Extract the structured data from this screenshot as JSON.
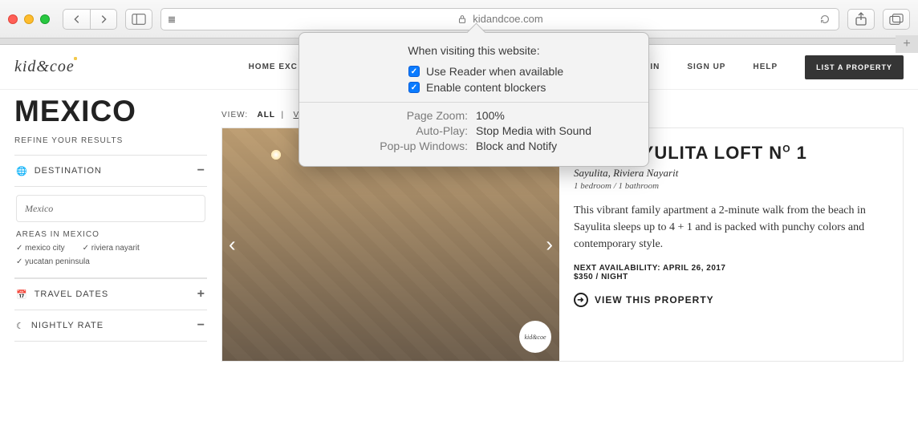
{
  "browser": {
    "url": "kidandcoe.com",
    "popover": {
      "title": "When visiting this website:",
      "useReader": "Use Reader when available",
      "contentBlockers": "Enable content blockers",
      "settings": [
        {
          "k": "Page Zoom:",
          "v": "100%"
        },
        {
          "k": "Auto-Play:",
          "v": "Stop Media with Sound"
        },
        {
          "k": "Pop-up Windows:",
          "v": "Block and Notify"
        }
      ]
    }
  },
  "site": {
    "logo": "kid&coe",
    "nav": {
      "homeExchange": "HOME EXC",
      "signIn": "S IN",
      "signUp": "SIGN UP",
      "help": "HELP",
      "cta": "LIST A PROPERTY"
    },
    "heading": "MEXICO",
    "refine": "REFINE YOUR RESULTS",
    "viewLine": {
      "label": "VIEW:",
      "all": "ALL",
      "other": "V"
    },
    "facets": {
      "destination": {
        "label": "DESTINATION",
        "input": "Mexico",
        "areasHead": "AREAS IN MEXICO",
        "areas": [
          "mexico city",
          "riviera nayarit",
          "yucatan peninsula"
        ]
      },
      "travelDates": "TRAVEL DATES",
      "nightlyRate": "NIGHTLY RATE"
    },
    "listing": {
      "title_prefix": "THE SAYULITA LOFT N",
      "title_super": "O",
      "title_num": " 1",
      "location": "Sayulita, Riviera Nayarit",
      "beds": "1 bedroom / 1 bathroom",
      "desc": "This vibrant family apartment a 2-minute walk from the beach in Sayulita sleeps up to 4 + 1 and is packed with punchy colors and contemporary style.",
      "availLabel": "NEXT AVAILABILITY: APRIL 26, 2017",
      "price": "$350 / NIGHT",
      "viewProp": "VIEW THIS PROPERTY",
      "badge": "kid&coe"
    }
  }
}
